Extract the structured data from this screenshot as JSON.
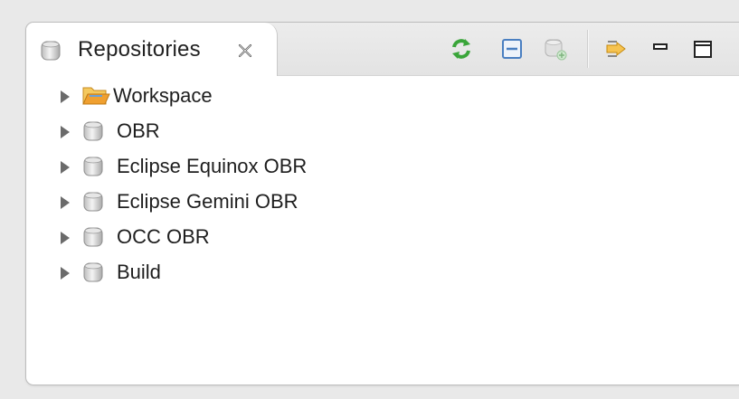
{
  "view": {
    "title": "Repositories",
    "icons": {
      "tab": "repository-icon",
      "close": "close-icon",
      "refresh": "refresh-icon",
      "collapse_all": "collapse-all-icon",
      "add_repository": "add-repository-icon",
      "view_menu": "view-menu-icon",
      "minimize": "minimize-icon",
      "maximize": "maximize-icon"
    }
  },
  "tree": {
    "items": [
      {
        "label": "Workspace",
        "icon": "folder-icon"
      },
      {
        "label": "OBR",
        "icon": "repository-icon"
      },
      {
        "label": "Eclipse Equinox OBR",
        "icon": "repository-icon"
      },
      {
        "label": "Eclipse Gemini OBR",
        "icon": "repository-icon"
      },
      {
        "label": "OCC OBR",
        "icon": "repository-icon"
      },
      {
        "label": "Build",
        "icon": "repository-icon"
      }
    ]
  },
  "colors": {
    "accent_green": "#3aa53a",
    "collapse_blue": "#4a7fc1",
    "folder_orange": "#f0a030"
  }
}
